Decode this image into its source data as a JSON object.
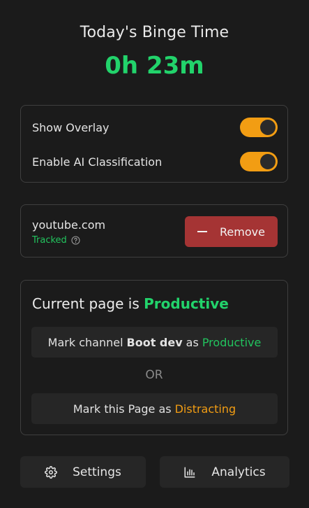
{
  "header": {
    "title": "Today's Binge Time",
    "time": "0h 23m"
  },
  "settings": {
    "show_overlay_label": "Show Overlay",
    "show_overlay_on": true,
    "ai_classification_label": "Enable AI Classification",
    "ai_classification_on": true
  },
  "site": {
    "name": "youtube.com",
    "status": "Tracked",
    "remove_label": "Remove"
  },
  "classification": {
    "prefix": "Current page is",
    "status": "Productive",
    "mark_channel": {
      "prefix": "Mark channel",
      "channel": "Boot dev",
      "as": "as",
      "target": "Productive"
    },
    "or_label": "OR",
    "mark_page": {
      "prefix": "Mark this Page as",
      "target": "Distracting"
    }
  },
  "footer": {
    "settings_label": "Settings",
    "analytics_label": "Analytics"
  },
  "icons": {
    "help": "help-circle-icon",
    "minus": "minus-icon",
    "settings": "gear-icon",
    "analytics": "bar-chart-icon"
  },
  "colors": {
    "background": "#1b1b1b",
    "accent_green": "#22d36b",
    "toggle_orange": "#f29d13",
    "remove_red": "#a53434"
  }
}
